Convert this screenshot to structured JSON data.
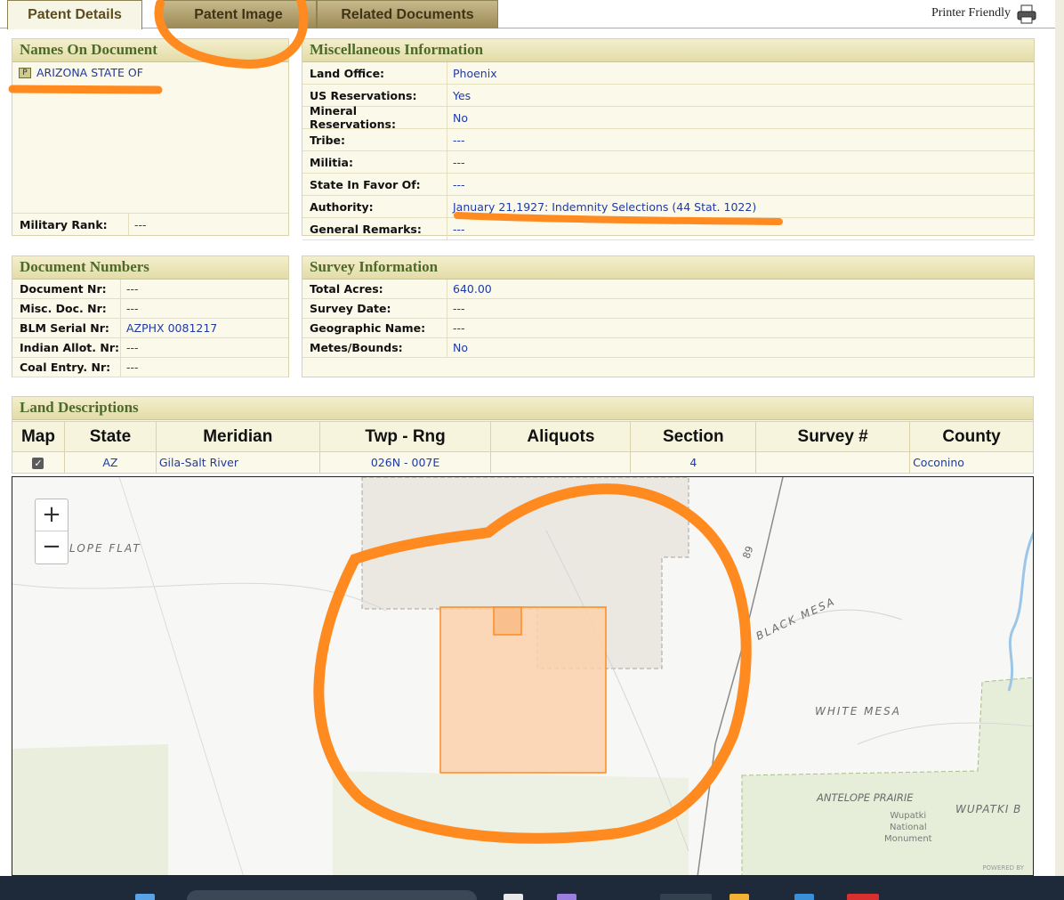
{
  "tabs": {
    "details": "Patent Details",
    "image": "Patent Image",
    "related": "Related Documents",
    "printer": "Printer Friendly"
  },
  "names": {
    "title": "Names On Document",
    "badge": "P",
    "name": "ARIZONA STATE OF",
    "rank_label": "Military Rank:",
    "rank_value": "---"
  },
  "misc": {
    "title": "Miscellaneous Information",
    "rows": [
      {
        "label": "Land Office:",
        "value": "Phoenix"
      },
      {
        "label": "US Reservations:",
        "value": "Yes"
      },
      {
        "label": "Mineral Reservations:",
        "value": "No"
      },
      {
        "label": "Tribe:",
        "value": "---"
      },
      {
        "label": "Militia:",
        "value": "---"
      },
      {
        "label": "State In Favor Of:",
        "value": "---"
      },
      {
        "label": "Authority:",
        "value": "January 21,1927: Indemnity Selections (44 Stat. 1022)"
      },
      {
        "label": "General Remarks:",
        "value": "---"
      }
    ]
  },
  "docnums": {
    "title": "Document Numbers",
    "rows": [
      {
        "label": "Document Nr:",
        "value": "---"
      },
      {
        "label": "Misc. Doc. Nr:",
        "value": "---"
      },
      {
        "label": "BLM Serial Nr:",
        "value": "AZPHX 0081217"
      },
      {
        "label": "Indian Allot. Nr:",
        "value": "---"
      },
      {
        "label": "Coal Entry. Nr:",
        "value": "---"
      }
    ]
  },
  "survey": {
    "title": "Survey Information",
    "rows": [
      {
        "label": "Total Acres:",
        "value": "640.00"
      },
      {
        "label": "Survey Date:",
        "value": "---"
      },
      {
        "label": "Geographic Name:",
        "value": "---"
      },
      {
        "label": "Metes/Bounds:",
        "value": "No"
      }
    ]
  },
  "land": {
    "title": "Land Descriptions",
    "headers": [
      "Map",
      "State",
      "Meridian",
      "Twp - Rng",
      "Aliquots",
      "Section",
      "Survey #",
      "County"
    ],
    "row": {
      "state": "AZ",
      "meridian": "Gila-Salt River",
      "twp_rng": "026N - 007E",
      "aliquots": "",
      "section": "4",
      "survey": "",
      "county": "Coconino"
    }
  },
  "map": {
    "zoom_in": "+",
    "zoom_out": "−",
    "labels": {
      "antelope_flat": "LOPE FLAT",
      "black_mesa": "BLACK MESA",
      "white_mesa": "WHITE MESA",
      "antelope_prairie": "ANTELOPE PRAIRIE",
      "wupatki": "WUPATKI B",
      "monument_1": "Wupatki",
      "monument_2": "National",
      "monument_3": "Monument",
      "route": "89",
      "powered": "POWERED BY"
    }
  },
  "colors": {
    "accent_green": "#4d6a2a",
    "link_blue": "#1f3aa3",
    "highlight_orange": "#ff8a1f"
  }
}
